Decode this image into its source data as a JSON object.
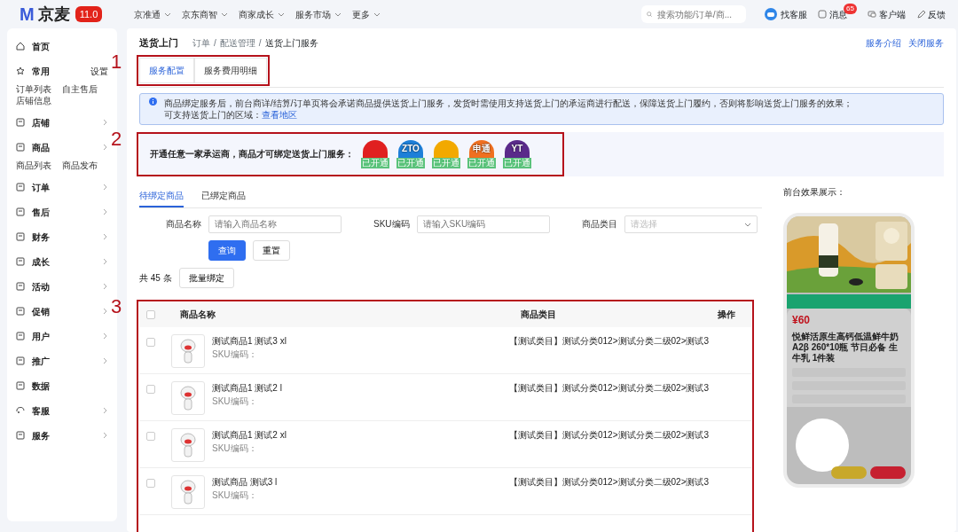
{
  "topbar": {
    "logo_mark": "M",
    "logo_text": "京麦",
    "version": "11.0",
    "menus": [
      {
        "label": "京准通"
      },
      {
        "label": "京东商智"
      },
      {
        "label": "商家成长"
      },
      {
        "label": "服务市场"
      },
      {
        "label": "更多"
      }
    ],
    "search": {
      "placeholder": "搜索功能/订单/商..."
    },
    "actions": [
      {
        "kind": "support",
        "label": "找客服"
      },
      {
        "kind": "message",
        "label": "消息",
        "count": "65"
      },
      {
        "kind": "client",
        "label": "客户端"
      },
      {
        "kind": "feedback",
        "label": "反馈"
      }
    ]
  },
  "sidebar": {
    "items": [
      {
        "kind": "home",
        "label": "首页"
      },
      {
        "kind": "favorites",
        "label": "常用",
        "action": "设置",
        "links": [
          "订单列表",
          "自主售后",
          "店铺信息"
        ]
      },
      {
        "kind": "menu",
        "label": "店铺",
        "expandable": true
      },
      {
        "kind": "menu",
        "label": "商品",
        "expandable": true,
        "links": [
          "商品列表",
          "商品发布"
        ]
      },
      {
        "kind": "menu",
        "label": "订单",
        "expandable": true
      },
      {
        "kind": "menu",
        "label": "售后",
        "expandable": true
      },
      {
        "kind": "menu",
        "label": "财务",
        "expandable": true
      },
      {
        "kind": "menu",
        "label": "成长",
        "expandable": true
      },
      {
        "kind": "menu",
        "label": "活动",
        "expandable": true
      },
      {
        "kind": "menu",
        "label": "促销",
        "expandable": true
      },
      {
        "kind": "menu",
        "label": "用户",
        "expandable": true
      },
      {
        "kind": "menu",
        "label": "推广",
        "expandable": true
      },
      {
        "kind": "menu",
        "label": "数据",
        "expandable": false
      },
      {
        "kind": "service",
        "label": "客服",
        "expandable": true
      },
      {
        "kind": "menu",
        "label": "服务",
        "expandable": true
      }
    ]
  },
  "page": {
    "title": "送货上门",
    "breadcrumb": [
      "订单",
      "配送管理",
      "送货上门服务"
    ],
    "breadcrumb_separator": "/",
    "links": [
      "服务介绍",
      "关闭服务"
    ],
    "tabs": [
      {
        "label": "服务配置",
        "selected": true
      },
      {
        "label": "服务费用明细",
        "selected": false
      }
    ],
    "notice": {
      "line_1": "商品绑定服务后，前台商详/结算/订单页将会承诺商品提供送货上门服务，发货时需使用支持送货上门的承运商进行配送，保障送货上门履约，否则将影响送货上门服务的效果；",
      "line_2": "可支持送货上门的区域：",
      "link": "查看地区"
    },
    "carriers": {
      "label": "开通任意一家承运商，商品才可绑定送货上门服务：",
      "items": [
        {
          "color": "#e02020",
          "status": "已开通"
        },
        {
          "logo": "ZTO",
          "color": "#1e7fd8",
          "status": "已开通"
        },
        {
          "color": "#f2a900",
          "status": "已开通"
        },
        {
          "logo": "申通",
          "color": "#f07020",
          "status": "已开通"
        },
        {
          "logo": "YT",
          "color": "#5a2a8a",
          "status": "已开通"
        }
      ]
    },
    "subtabs": [
      {
        "label": "待绑定商品",
        "selected": true
      },
      {
        "label": "已绑定商品",
        "selected": false
      }
    ],
    "filters": [
      {
        "label": "商品名称",
        "kind": "input",
        "placeholder": "请输入商品名称"
      },
      {
        "label": "SKU编码",
        "kind": "input",
        "placeholder": "请输入SKU编码"
      },
      {
        "label": "商品类目",
        "kind": "select",
        "placeholder": "请选择"
      }
    ],
    "buttons": [
      {
        "label": "查询",
        "kind": "primary"
      },
      {
        "label": "重置",
        "kind": "default"
      }
    ],
    "count": "共 45 条",
    "batch_button": "批量绑定",
    "table": {
      "columns": [
        "商品名称",
        "商品类目",
        "操作"
      ],
      "all_checked": false,
      "rows": [
        {
          "checked": false,
          "name": "测试商品1 测试3 xl",
          "sku": "SKU编码：",
          "category": "【测试类目】测试分类012>测试分类二级02>测试3"
        },
        {
          "checked": false,
          "name": "测试商品1 测试2 l",
          "sku": "SKU编码：",
          "category": "【测试类目】测试分类012>测试分类二级02>测试3"
        },
        {
          "checked": false,
          "name": "测试商品1 测试2 xl",
          "sku": "SKU编码：",
          "category": "【测试类目】测试分类012>测试分类二级02>测试3"
        },
        {
          "checked": false,
          "name": "测试商品 测试3 l",
          "sku": "SKU编码：",
          "category": "【测试类目】测试分类012>测试分类二级02>测试3"
        }
      ]
    },
    "preview": {
      "label": "前台效果展示：",
      "price": "¥60",
      "product_title": "悦鲜活原生高钙低温鲜牛奶A2β 260*10瓶 节日必备 生牛乳 1件装"
    },
    "annotations": [
      "1",
      "2",
      "3"
    ]
  }
}
